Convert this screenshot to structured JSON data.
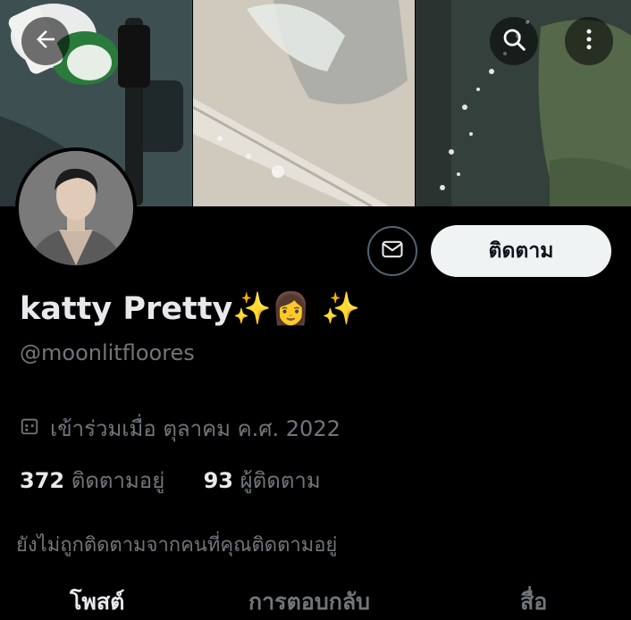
{
  "header": {
    "back_icon": "arrow-left-icon",
    "search_icon": "search-icon",
    "more_icon": "more-vertical-icon"
  },
  "profile": {
    "display_name": "katty Pretty✨👩 ✨",
    "handle": "@moonlitfloores",
    "joined": "เข้าร่วมเมื่อ ตุลาคม ค.ศ. 2022",
    "following_count": "372",
    "following_label": "ติดตามอยู่",
    "followers_count": "93",
    "followers_label": "ผู้ติดตาม",
    "not_followed_notice": "ยังไม่ถูกติดตามจากคนที่คุณติดตามอยู่"
  },
  "actions": {
    "follow_label": "ติดตาม",
    "message_icon": "mail-icon"
  },
  "tabs": [
    {
      "label": "โพสต์"
    },
    {
      "label": "การตอบกลับ"
    },
    {
      "label": "สื่อ"
    }
  ],
  "colors": {
    "background": "#000000",
    "primary_text": "#e7e9ea",
    "secondary_text": "#71767b",
    "follow_button_bg": "#eff3f4"
  }
}
